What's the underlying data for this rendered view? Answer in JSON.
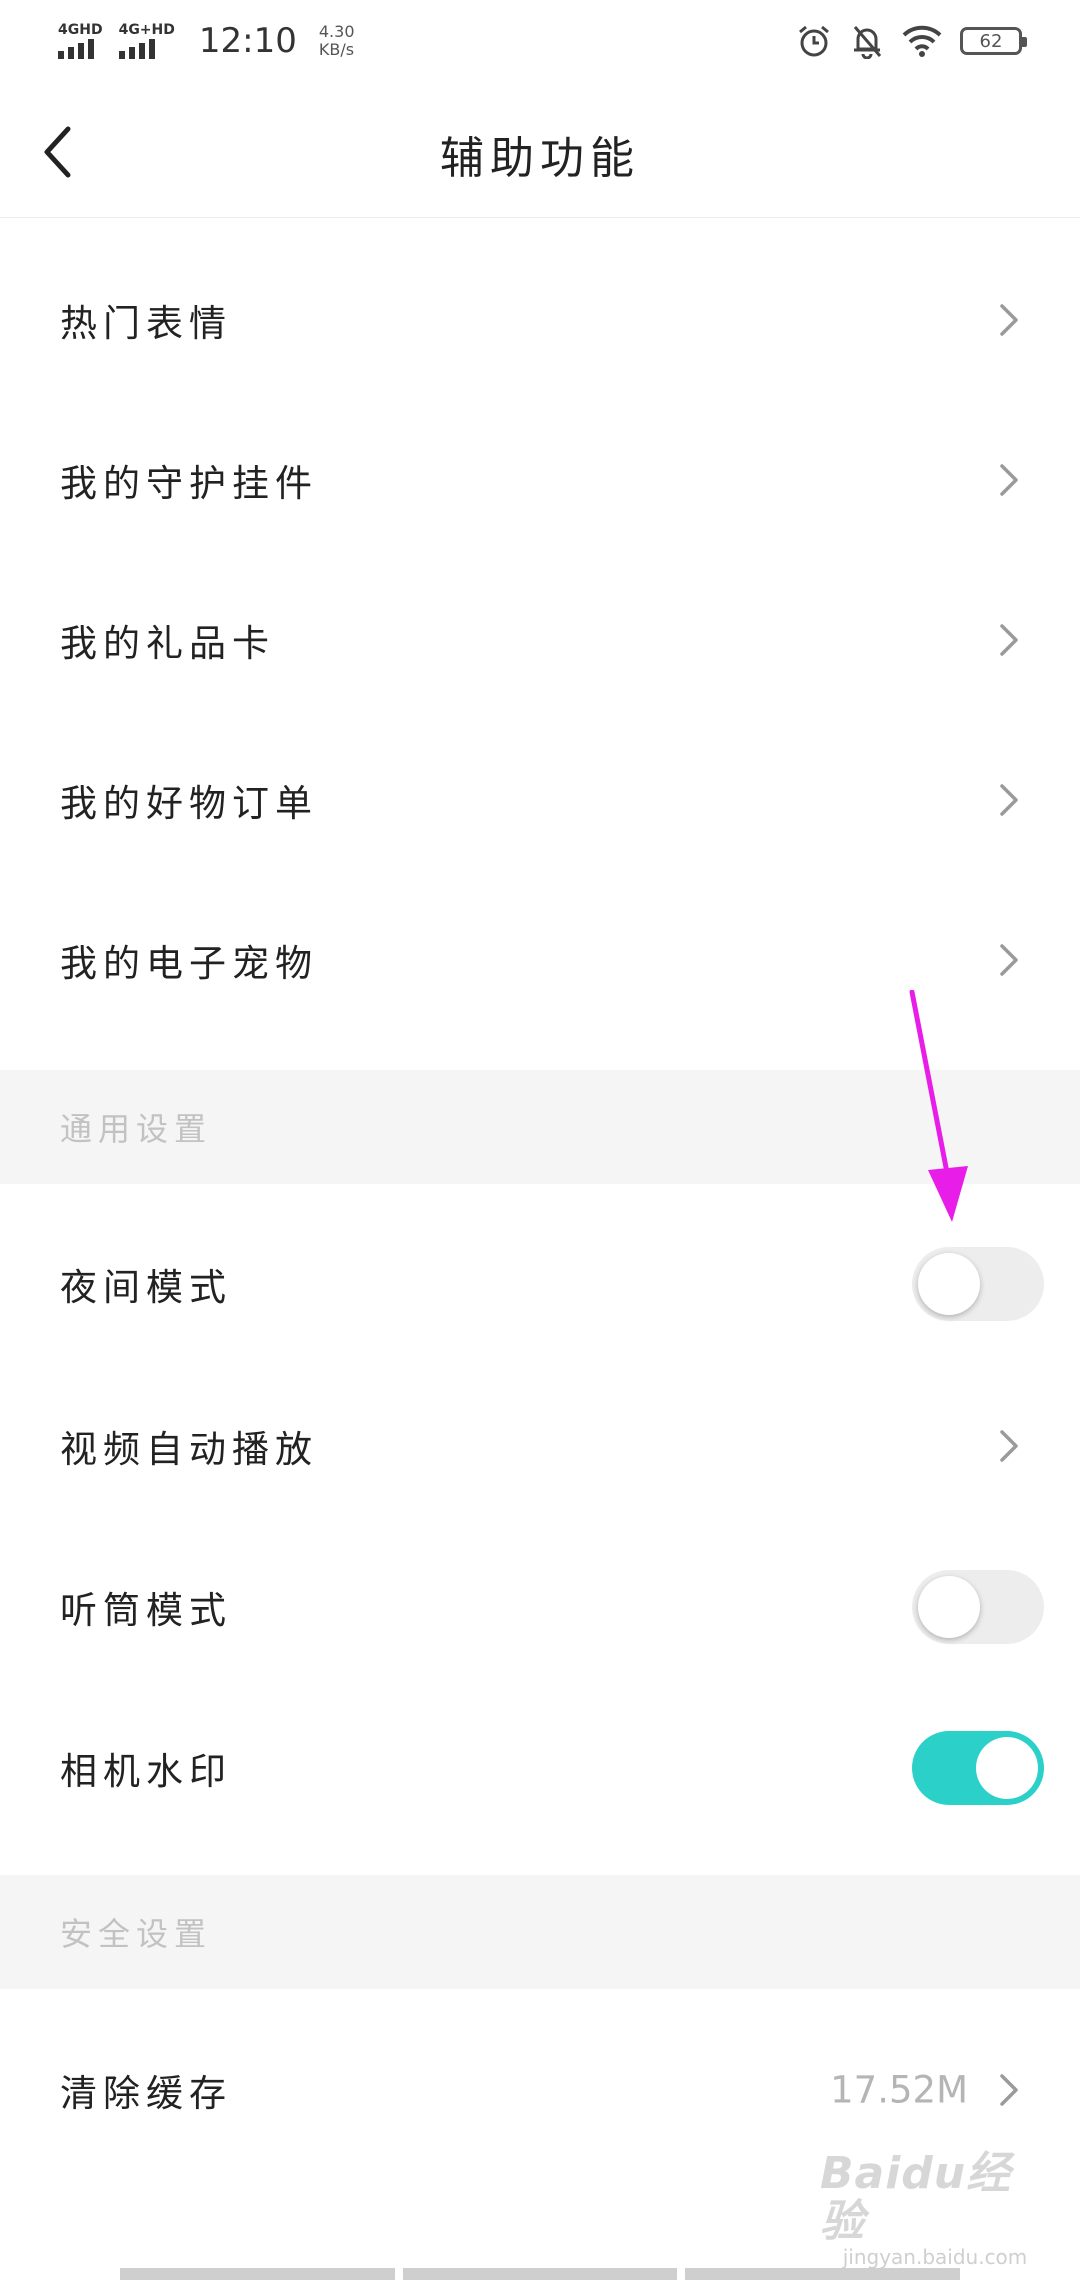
{
  "status_bar": {
    "sim1_label": "4GHD",
    "sim2_label": "4G+HD",
    "time": "12:10",
    "speed_value": "4.30",
    "speed_unit": "KB/s",
    "battery": "62",
    "icons": [
      "alarm-icon",
      "bell-off-icon",
      "wifi-icon",
      "battery-icon"
    ]
  },
  "nav": {
    "title": "辅助功能",
    "back_icon": "chevron-left-icon"
  },
  "menu_items": [
    {
      "label": "热门表情"
    },
    {
      "label": "我的守护挂件"
    },
    {
      "label": "我的礼品卡"
    },
    {
      "label": "我的好物订单"
    },
    {
      "label": "我的电子宠物"
    }
  ],
  "general_section": {
    "title": "通用设置",
    "items": [
      {
        "label": "夜间模式",
        "type": "toggle",
        "on": false
      },
      {
        "label": "视频自动播放",
        "type": "link"
      },
      {
        "label": "听筒模式",
        "type": "toggle",
        "on": false
      },
      {
        "label": "相机水印",
        "type": "toggle",
        "on": true
      }
    ]
  },
  "security_section": {
    "title": "安全设置",
    "items": [
      {
        "label": "清除缓存",
        "value": "17.52M"
      }
    ]
  },
  "colors": {
    "toggle_on": "#2bd0c8",
    "toggle_off": "#ededed",
    "annotation_arrow": "#e81ee8",
    "section_bg": "#f5f5f5"
  },
  "watermark": {
    "logo": "Baidu经验",
    "url": "jingyan.baidu.com"
  }
}
